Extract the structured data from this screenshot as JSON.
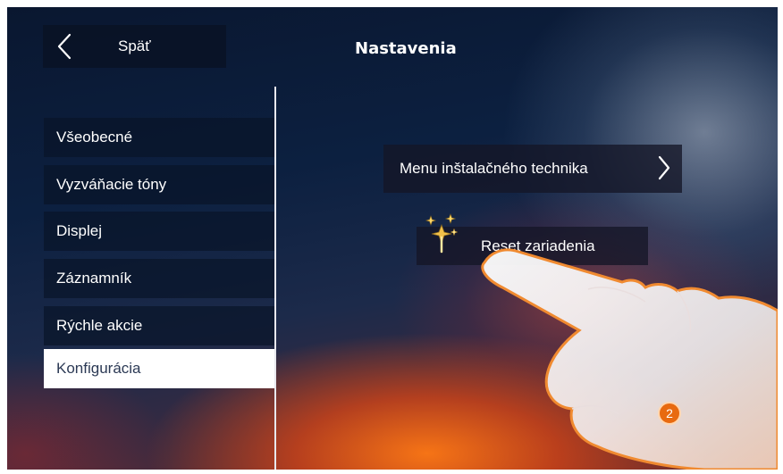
{
  "header": {
    "back_label": "Späť",
    "title": "Nastavenia"
  },
  "sidebar": {
    "items": [
      {
        "label": "Všeobecné",
        "active": false
      },
      {
        "label": "Vyzváňacie tóny",
        "active": false
      },
      {
        "label": "Displej",
        "active": false
      },
      {
        "label": "Záznamník",
        "active": false
      },
      {
        "label": "Rýchle akcie",
        "active": false
      },
      {
        "label": "Konfigurácia",
        "active": true
      }
    ]
  },
  "main": {
    "installer_menu_label": "Menu inštalačného technika",
    "reset_label": "Reset zariadenia",
    "step_badge": "2"
  },
  "colors": {
    "active_item_bg": "#ffffff",
    "active_item_text": "#2c3a55",
    "badge": "#e86a10"
  }
}
